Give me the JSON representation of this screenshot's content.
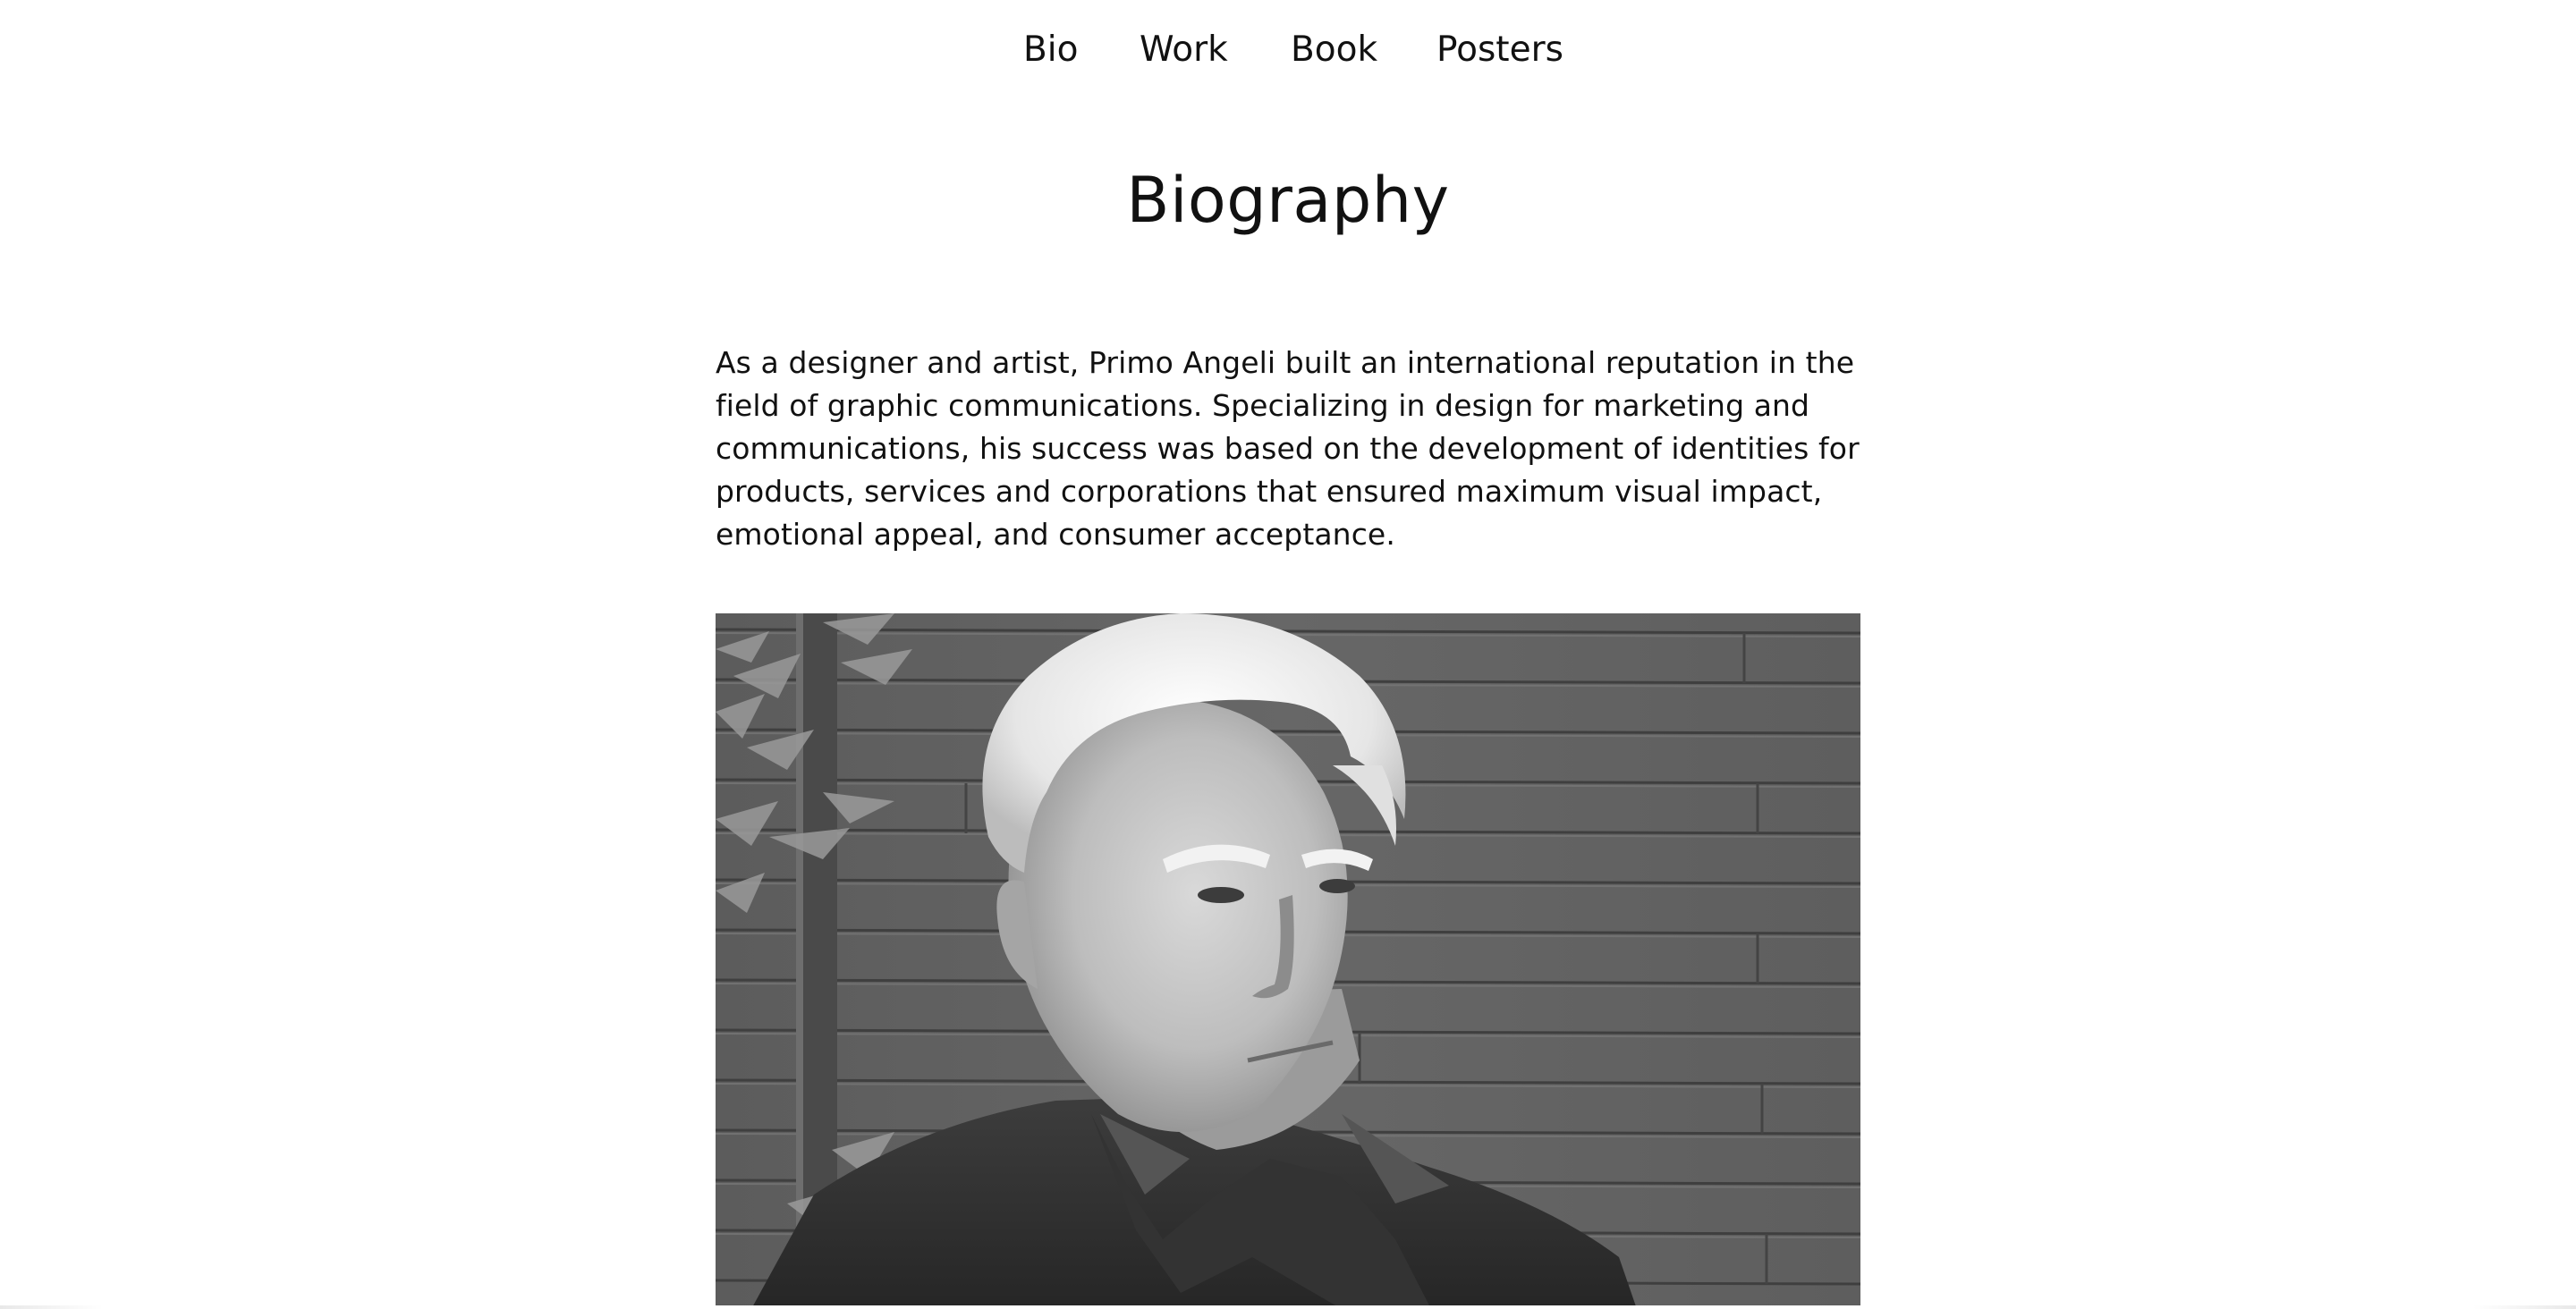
{
  "nav": {
    "items": [
      {
        "label": "Bio"
      },
      {
        "label": "Work"
      },
      {
        "label": "Book"
      },
      {
        "label": "Posters"
      }
    ]
  },
  "page": {
    "title": "Biography"
  },
  "bio": {
    "paragraph": "As a designer and artist, Primo Angeli built an international reputation in the field of graphic communications. Specializing in design for marketing and communications, his success was based on the development of identities for products, services and corporations that ensured maximum visual impact, emotional appeal, and consumer acceptance."
  },
  "photo": {
    "subject": "Primo Angeli portrait",
    "style": "black-and-white"
  },
  "colors": {
    "background": "#ffffff",
    "text": "#111111",
    "photo_tone": "#606060"
  }
}
